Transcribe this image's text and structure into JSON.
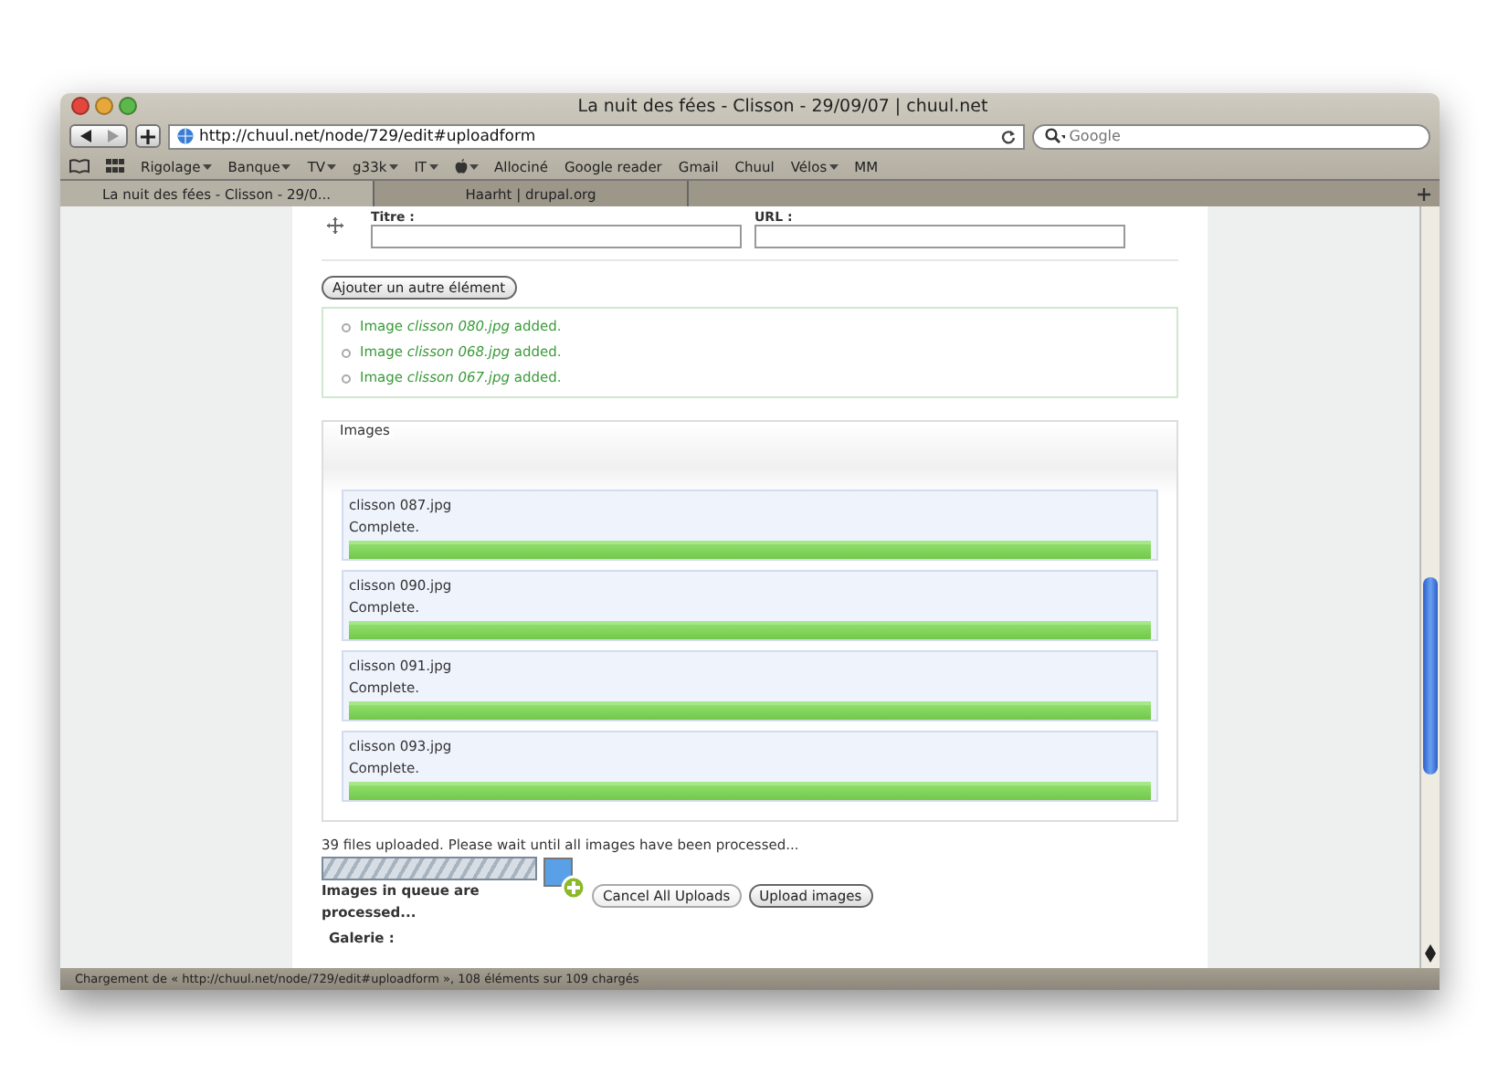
{
  "window": {
    "title": "La nuit des fées - Clisson - 29/09/07 | chuul.net"
  },
  "toolbar": {
    "url": "http://chuul.net/node/729/edit#uploadform",
    "search": {
      "placeholder": "Google"
    }
  },
  "bookmarks": [
    {
      "kind": "text",
      "label": "Rigolage",
      "has_menu": true
    },
    {
      "kind": "text",
      "label": "Banque",
      "has_menu": true
    },
    {
      "kind": "text",
      "label": "TV",
      "has_menu": true
    },
    {
      "kind": "text",
      "label": "g33k",
      "has_menu": true
    },
    {
      "kind": "text",
      "label": "IT",
      "has_menu": true
    },
    {
      "kind": "apple",
      "has_menu": true
    },
    {
      "kind": "text",
      "label": "Allociné",
      "has_menu": false
    },
    {
      "kind": "text",
      "label": "Google reader",
      "has_menu": false
    },
    {
      "kind": "text",
      "label": "Gmail",
      "has_menu": false
    },
    {
      "kind": "text",
      "label": "Chuul",
      "has_menu": false
    },
    {
      "kind": "text",
      "label": "Vélos",
      "has_menu": true
    },
    {
      "kind": "text",
      "label": "MM",
      "has_menu": false
    }
  ],
  "tabs": [
    {
      "label": "La nuit des fées - Clisson - 29/0...",
      "selected": true
    },
    {
      "label": "Haarht | drupal.org",
      "selected": false
    }
  ],
  "form": {
    "title_label": "Titre :",
    "url_label": "URL :",
    "add_button": "Ajouter un autre élément",
    "messages": [
      {
        "prefix": "Image ",
        "file": "clisson 080.jpg",
        "suffix": " added."
      },
      {
        "prefix": "Image ",
        "file": "clisson 068.jpg",
        "suffix": " added."
      },
      {
        "prefix": "Image ",
        "file": "clisson 067.jpg",
        "suffix": " added."
      }
    ],
    "images_legend": "Images",
    "uploads": [
      {
        "name": "clisson 087.jpg",
        "status": "Complete.",
        "level": 1
      },
      {
        "name": "clisson 090.jpg",
        "status": "Complete.",
        "level": 1
      },
      {
        "name": "clisson 091.jpg",
        "status": "Complete.",
        "level": 1
      },
      {
        "name": "clisson 093.jpg",
        "status": "Complete.",
        "level": 1
      }
    ],
    "upload_status": "39 files uploaded. Please wait until all images have been processed...",
    "queue_busy": true,
    "queue_text": "Images in queue are processed...",
    "cancel_button": "Cancel All Uploads",
    "upload_button": "Upload images",
    "gallery_label": "Galerie :"
  },
  "status_bar": "Chargement de « http://chuul.net/node/729/edit#uploadform », 108 éléments sur 109 chargés"
}
